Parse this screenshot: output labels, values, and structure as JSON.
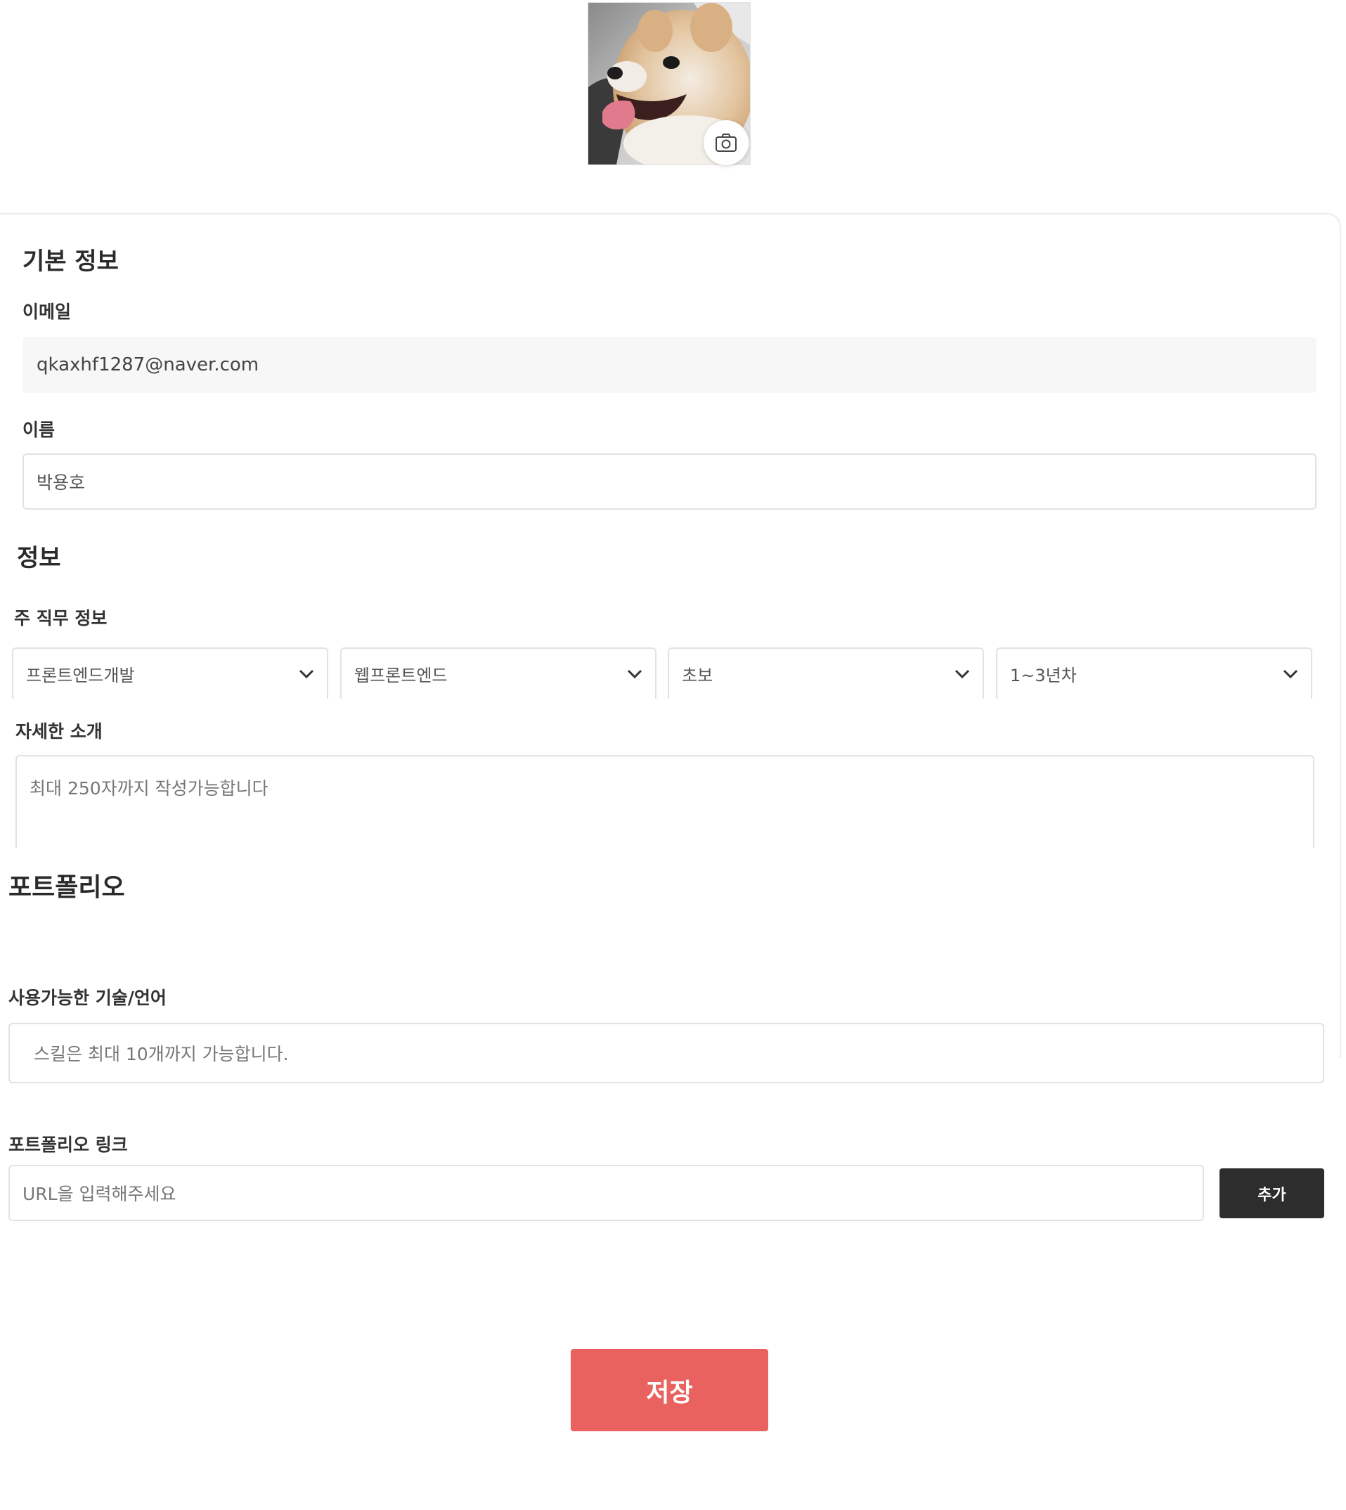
{
  "profile": {
    "photo_alt": "profile-photo",
    "camera_icon": "camera-icon"
  },
  "basic_info": {
    "title": "기본 정보",
    "email_label": "이메일",
    "email_value": "qkaxhf1287@naver.com",
    "name_label": "이름",
    "name_value": "박용호"
  },
  "info": {
    "title": "정보",
    "job_label": "주 직무 정보",
    "selects": [
      {
        "value": "프론트엔드개발",
        "icon": "chevron-down-icon"
      },
      {
        "value": "웹프론트엔드",
        "icon": "chevron-down-icon"
      },
      {
        "value": "초보",
        "icon": "chevron-down-icon"
      },
      {
        "value": "1~3년차",
        "icon": "chevron-down-icon"
      }
    ],
    "intro_label": "자세한 소개",
    "intro_placeholder": "최대 250자까지 작성가능합니다"
  },
  "portfolio": {
    "title": "포트폴리오",
    "skills_label": "사용가능한 기술/언어",
    "skills_placeholder": "스킬은 최대 10개까지 가능합니다.",
    "link_label": "포트폴리오 링크",
    "link_placeholder": "URL을 입력해주세요",
    "add_button": "추가"
  },
  "actions": {
    "save_button": "저장"
  },
  "colors": {
    "save_button_bg": "#e9625f",
    "add_button_bg": "#2d2d2d",
    "input_border": "#e2e2e2",
    "readonly_bg": "#f7f7f7"
  }
}
